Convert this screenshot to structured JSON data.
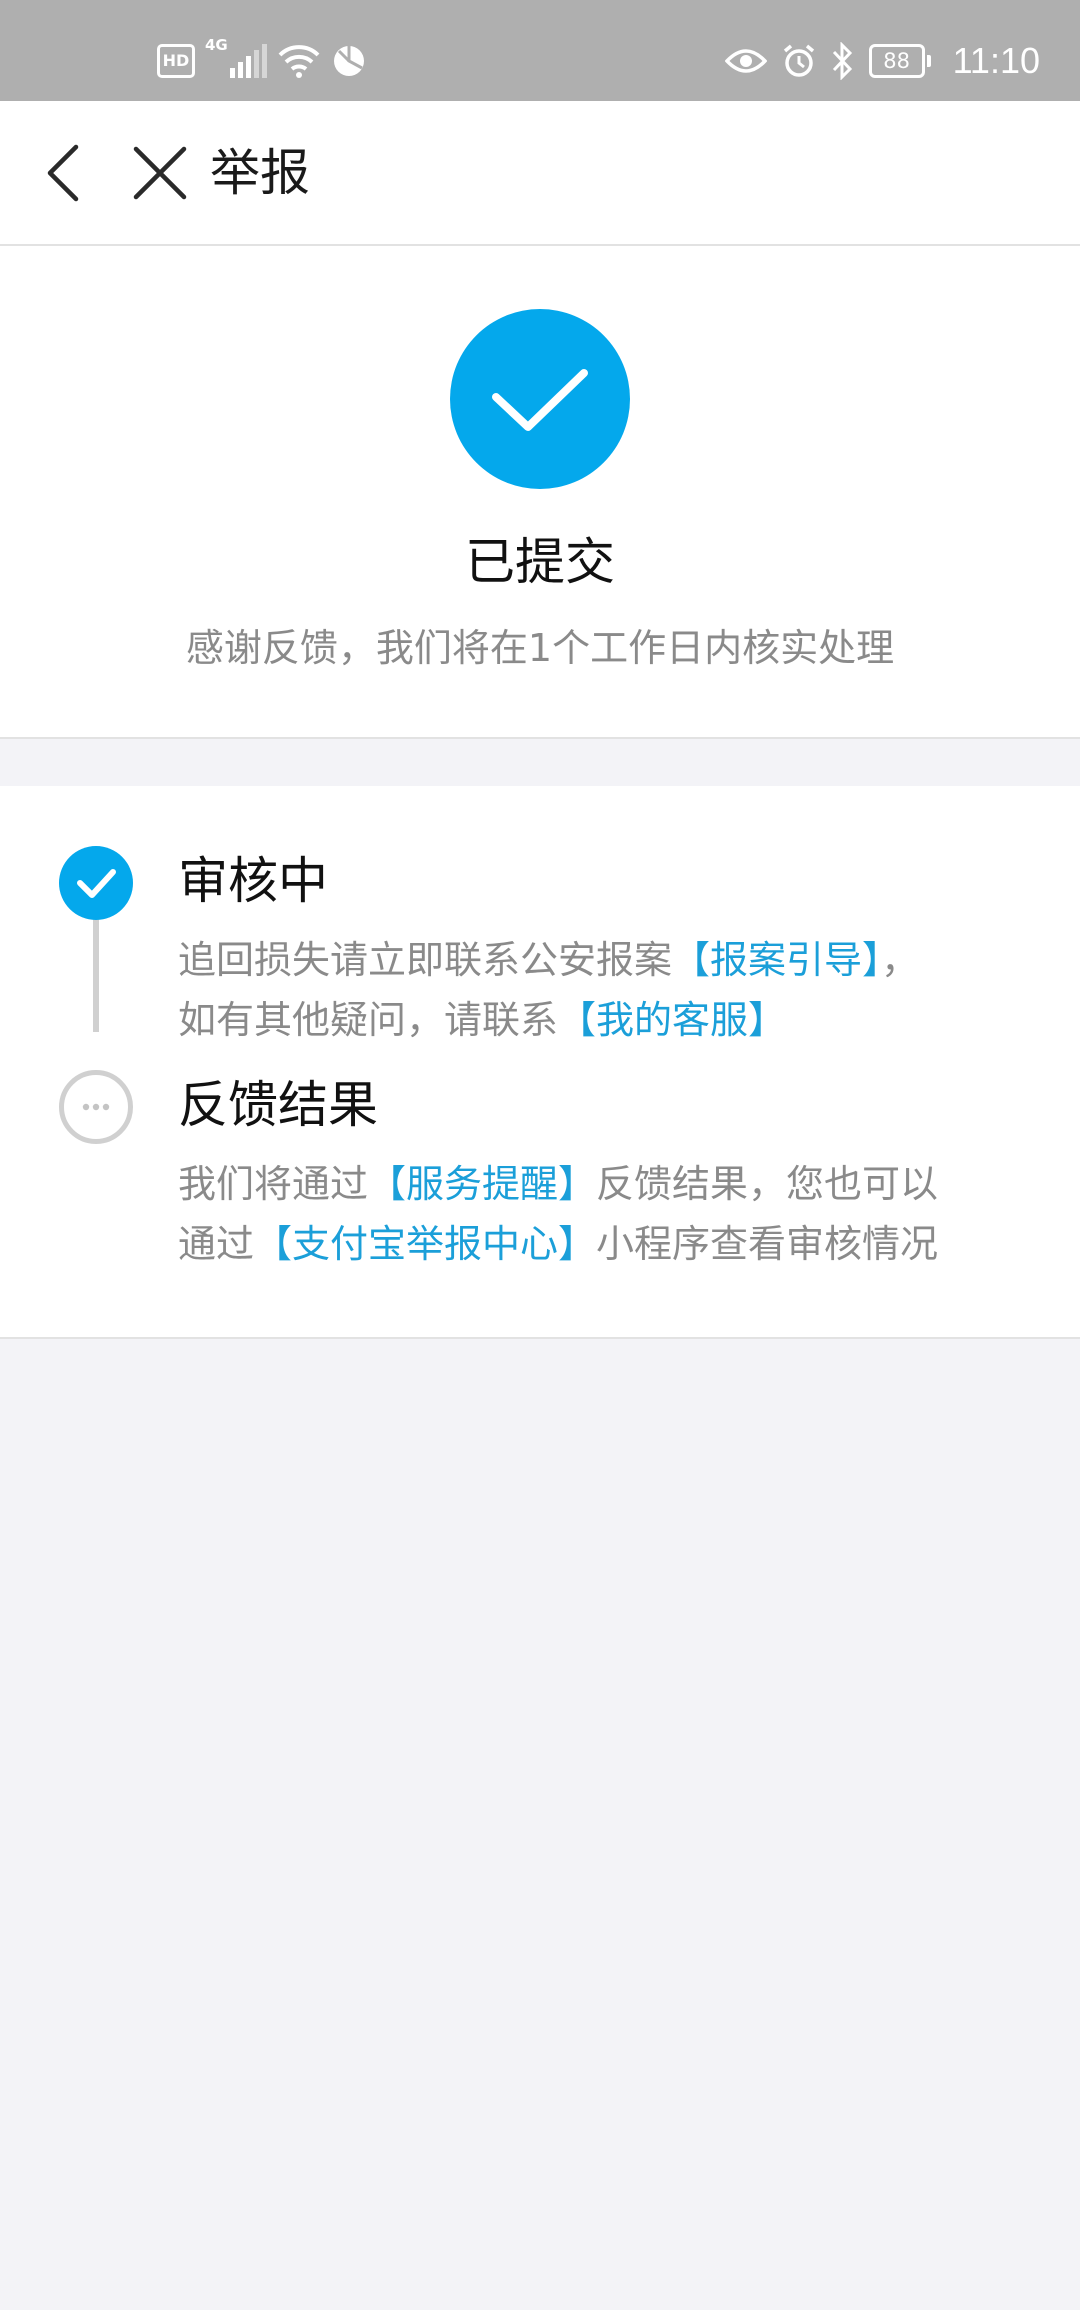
{
  "status_bar": {
    "hd_badge": "HD",
    "network_label": "4G",
    "battery": "88",
    "time": "11:10",
    "icons": [
      "hd-icon",
      "signal-icon",
      "wifi-icon",
      "data-saver-icon",
      "eye-icon",
      "alarm-icon",
      "bluetooth-icon",
      "battery-icon"
    ]
  },
  "nav": {
    "title": "举报",
    "back_icon": "chevron-left-icon",
    "close_icon": "close-icon"
  },
  "result": {
    "icon": "check-circle-icon",
    "title": "已提交",
    "subtitle": "感谢反馈，我们将在1个工作日内核实处理"
  },
  "steps": [
    {
      "title": "审核中",
      "state": "done",
      "desc_line1_text": "追回损失请立即联系公安报案",
      "desc_line1_link": "【报案引导】",
      "desc_line1_tail": "，",
      "desc_line2_text": "如有其他疑问，请联系",
      "desc_line2_link": "【我的客服】"
    },
    {
      "title": "反馈结果",
      "state": "pending",
      "desc_line1_text": "我们将通过",
      "desc_line1_link": "【服务提醒】",
      "desc_line1_tail": "反馈结果，您也可以",
      "desc_line2_text": "通过",
      "desc_line2_link": "【支付宝举报中心】",
      "desc_line2_tail": "小程序查看审核情况"
    }
  ],
  "colors": {
    "accent": "#04a8ec",
    "link": "#1b9fd9",
    "status_bar": "#afafaf",
    "page_bg": "#f3f3f7",
    "muted_text": "#8a8a8a"
  }
}
